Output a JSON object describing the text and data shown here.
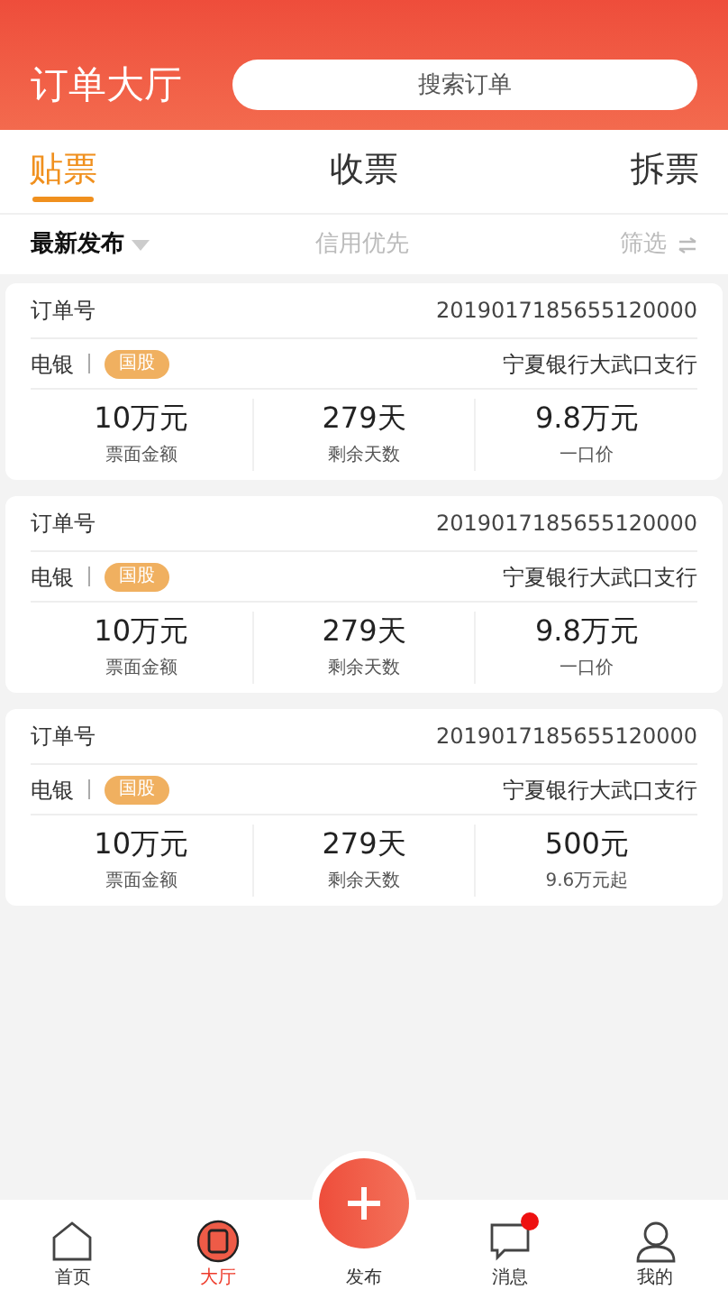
{
  "header": {
    "title": "订单大厅",
    "search": {
      "placeholder": "搜索订单"
    }
  },
  "tabs": [
    {
      "label": "贴票",
      "selected": true
    },
    {
      "label": "收票",
      "selected": false
    },
    {
      "label": "拆票",
      "selected": false
    }
  ],
  "sort": [
    {
      "label": "最新发布",
      "selected": true
    },
    {
      "label": "信用优先",
      "selected": false
    }
  ],
  "filter": {
    "label": "筛选"
  },
  "orders": [
    {
      "order_label": "订单号",
      "order_no": "2019017185655120000",
      "type": "电银",
      "tag": "国股",
      "bank": "宁夏银行大武口支行",
      "stats": [
        {
          "value": "10万元",
          "label": "票面金额"
        },
        {
          "value": "279天",
          "label": "剩余天数"
        },
        {
          "value": "9.8万元",
          "label": "一口价"
        }
      ]
    },
    {
      "order_label": "订单号",
      "order_no": "2019017185655120000",
      "type": "电银",
      "tag": "国股",
      "bank": "宁夏银行大武口支行",
      "stats": [
        {
          "value": "10万元",
          "label": "票面金额"
        },
        {
          "value": "279天",
          "label": "剩余天数"
        },
        {
          "value": "9.8万元",
          "label": "一口价"
        }
      ]
    },
    {
      "order_label": "订单号",
      "order_no": "2019017185655120000",
      "type": "电银",
      "tag": "国股",
      "bank": "宁夏银行大武口支行",
      "stats": [
        {
          "value": "10万元",
          "label": "票面金额"
        },
        {
          "value": "279天",
          "label": "剩余天数"
        },
        {
          "value": "500元",
          "label": "9.6万元起"
        }
      ]
    }
  ],
  "nav": [
    {
      "kind": "home",
      "label": "首页",
      "selected": false,
      "dot": false
    },
    {
      "kind": "hall",
      "label": "大厅",
      "selected": true,
      "dot": false
    },
    {
      "kind": "publish",
      "label": "发布",
      "selected": false,
      "dot": false
    },
    {
      "kind": "message",
      "label": "消息",
      "selected": false,
      "dot": true
    },
    {
      "kind": "profile",
      "label": "我的",
      "selected": false,
      "dot": false
    }
  ]
}
